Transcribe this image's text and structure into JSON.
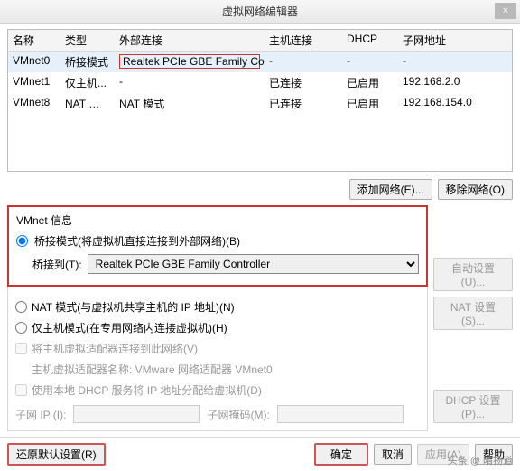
{
  "window": {
    "title": "虚拟网络编辑器",
    "close_icon": "×"
  },
  "table": {
    "headers": {
      "name": "名称",
      "type": "类型",
      "ext": "外部连接",
      "host": "主机连接",
      "dhcp": "DHCP",
      "subnet": "子网地址"
    },
    "rows": [
      {
        "name": "VMnet0",
        "type": "桥接模式",
        "ext": "Realtek PCIe GBE Family Co...",
        "host": "-",
        "dhcp": "-",
        "subnet": "-",
        "selected": true
      },
      {
        "name": "VMnet1",
        "type": "仅主机...",
        "ext": "-",
        "host": "已连接",
        "dhcp": "已启用",
        "subnet": "192.168.2.0",
        "selected": false
      },
      {
        "name": "VMnet8",
        "type": "NAT 模式",
        "ext": "NAT 模式",
        "host": "已连接",
        "dhcp": "已启用",
        "subnet": "192.168.154.0",
        "selected": false
      }
    ]
  },
  "buttons": {
    "add": "添加网络(E)...",
    "remove": "移除网络(O)",
    "auto": "自动设置(U)...",
    "nat": "NAT 设置(S)...",
    "dhcp": "DHCP 设置(P)...",
    "restore": "还原默认设置(R)",
    "ok": "确定",
    "cancel": "取消",
    "apply": "应用(A)",
    "help": "帮助"
  },
  "group": {
    "legend": "VMnet 信息",
    "bridge_label": "桥接模式(将虚拟机直接连接到外部网络)(B)",
    "bridge_to": "桥接到(T):",
    "bridge_adapter": "Realtek PCIe GBE Family Controller",
    "nat_label": "NAT 模式(与虚拟机共享主机的 IP 地址)(N)",
    "hostonly_label": "仅主机模式(在专用网络内连接虚拟机)(H)",
    "connect_host": "将主机虚拟适配器连接到此网络(V)",
    "host_adapter_name": "主机虚拟适配器名称: VMware 网络适配器 VMnet0",
    "use_dhcp": "使用本地 DHCP 服务将 IP 地址分配给虚拟机(D)",
    "subnet_ip": "子网 IP (I):",
    "subnet_mask": "子网掩码(M):"
  },
  "watermark": "头条 @ 晴扬道"
}
